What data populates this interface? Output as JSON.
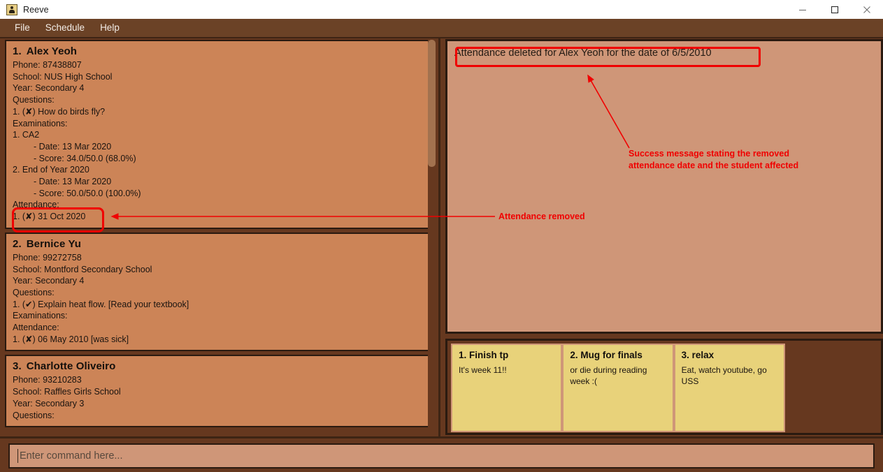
{
  "window": {
    "title": "Reeve",
    "icon": "app-person-icon",
    "minimize_label": "─",
    "maximize_label": "□",
    "close_label": "✕"
  },
  "menubar": {
    "items": [
      {
        "label": "File"
      },
      {
        "label": "Schedule"
      },
      {
        "label": "Help"
      }
    ]
  },
  "students": [
    {
      "index": "1.",
      "name": "Alex Yeoh",
      "lines": [
        {
          "text": "Phone: 87438807",
          "indent": false
        },
        {
          "text": "School: NUS High School",
          "indent": false
        },
        {
          "text": "Year: Secondary 4",
          "indent": false
        },
        {
          "text": "Questions:",
          "indent": false
        },
        {
          "text": "1. (✘) How do birds fly?",
          "indent": false
        },
        {
          "text": "Examinations:",
          "indent": false
        },
        {
          "text": "1. CA2",
          "indent": false
        },
        {
          "text": "- Date: 13 Mar 2020",
          "indent": true
        },
        {
          "text": "- Score: 34.0/50.0 (68.0%)",
          "indent": true
        },
        {
          "text": "2. End of Year 2020",
          "indent": false
        },
        {
          "text": "- Date: 13 Mar 2020",
          "indent": true
        },
        {
          "text": "- Score: 50.0/50.0 (100.0%)",
          "indent": true
        },
        {
          "text": "Attendance:",
          "indent": false
        },
        {
          "text": "1. (✘) 31 Oct 2020",
          "indent": false
        }
      ]
    },
    {
      "index": "2.",
      "name": "Bernice Yu",
      "lines": [
        {
          "text": "Phone: 99272758",
          "indent": false
        },
        {
          "text": "School: Montford Secondary School",
          "indent": false
        },
        {
          "text": "Year: Secondary 4",
          "indent": false
        },
        {
          "text": "Questions:",
          "indent": false
        },
        {
          "text": "1. (✔) Explain heat flow. [Read your textbook]",
          "indent": false
        },
        {
          "text": "Examinations:",
          "indent": false
        },
        {
          "text": "Attendance:",
          "indent": false
        },
        {
          "text": "1. (✘) 06 May 2010 [was sick]",
          "indent": false
        }
      ]
    },
    {
      "index": "3.",
      "name": "Charlotte Oliveiro",
      "lines": [
        {
          "text": "Phone: 93210283",
          "indent": false
        },
        {
          "text": "School: Raffles Girls School",
          "indent": false
        },
        {
          "text": "Year: Secondary 3",
          "indent": false
        },
        {
          "text": "Questions:",
          "indent": false
        }
      ]
    }
  ],
  "result": {
    "message": "Attendance deleted for Alex Yeoh for the date of 6/5/2010"
  },
  "notes": [
    {
      "title": "1. Finish tp",
      "body": "It's week 11!!"
    },
    {
      "title": "2. Mug for finals",
      "body": "or die during reading week :("
    },
    {
      "title": "3. relax",
      "body": "Eat, watch youtube, go USS"
    }
  ],
  "command": {
    "placeholder": "Enter command here...",
    "value": ""
  },
  "annotations": {
    "attendance_removed": "Attendance removed",
    "success_message": "Success message stating the removed\nattendance date and the student affected",
    "color": "#f00000"
  }
}
